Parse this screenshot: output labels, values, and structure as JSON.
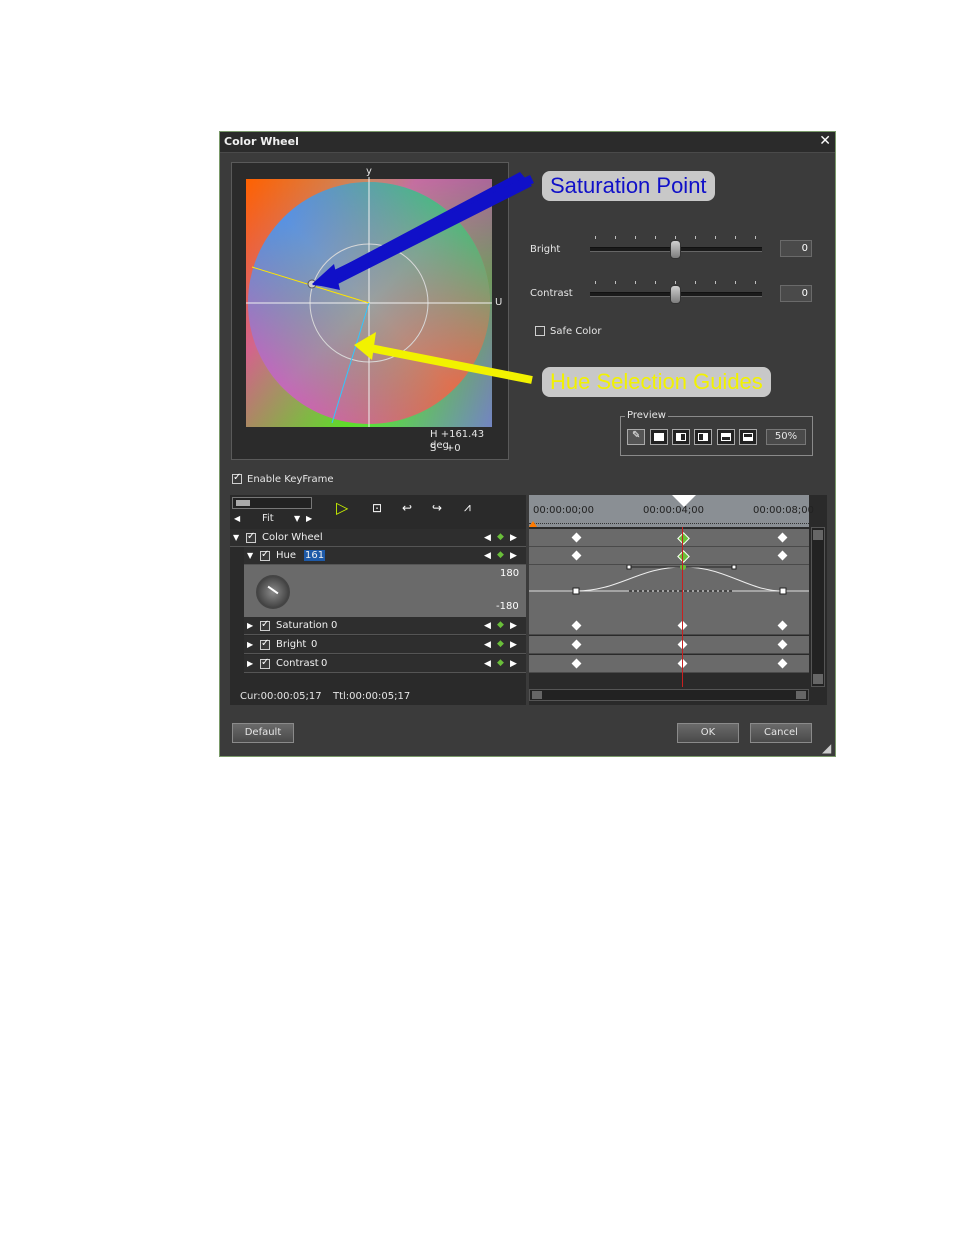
{
  "window": {
    "title": "Color Wheel",
    "close_glyph": "✕"
  },
  "wheel": {
    "y_axis": "y",
    "u_axis": "U",
    "h_value": "H +161.43 deg.",
    "s_value": "S   +0"
  },
  "callouts": {
    "saturation": "Saturation Point",
    "hue": "Hue Selection Guides",
    "saturation_color": "#1010c8",
    "hue_color": "#f2f200"
  },
  "bright": {
    "label": "Bright",
    "value": "0"
  },
  "contrast": {
    "label": "Contrast",
    "value": "0"
  },
  "safe_color": {
    "label": "Safe Color",
    "checked": false
  },
  "preview": {
    "label": "Preview",
    "zoom": "50%"
  },
  "keyframe": {
    "enable_label": "Enable KeyFrame",
    "checked": true
  },
  "timeline": {
    "fit_label": "Fit",
    "times": [
      "00:00:00;00",
      "00:00:04;00",
      "00:00:08;00"
    ],
    "cur": "Cur:00:00:05;17",
    "ttl": "Ttl:00:00:05;17"
  },
  "tracks": {
    "color_wheel": {
      "label": "Color Wheel"
    },
    "hue": {
      "label": "Hue",
      "value": "161",
      "max": "180",
      "min": "-180"
    },
    "saturation": {
      "label": "Saturation",
      "value": "0"
    },
    "bright": {
      "label": "Bright",
      "value": "0"
    },
    "contrast": {
      "label": "Contrast",
      "value": "0"
    }
  },
  "buttons": {
    "default": "Default",
    "ok": "OK",
    "cancel": "Cancel"
  }
}
